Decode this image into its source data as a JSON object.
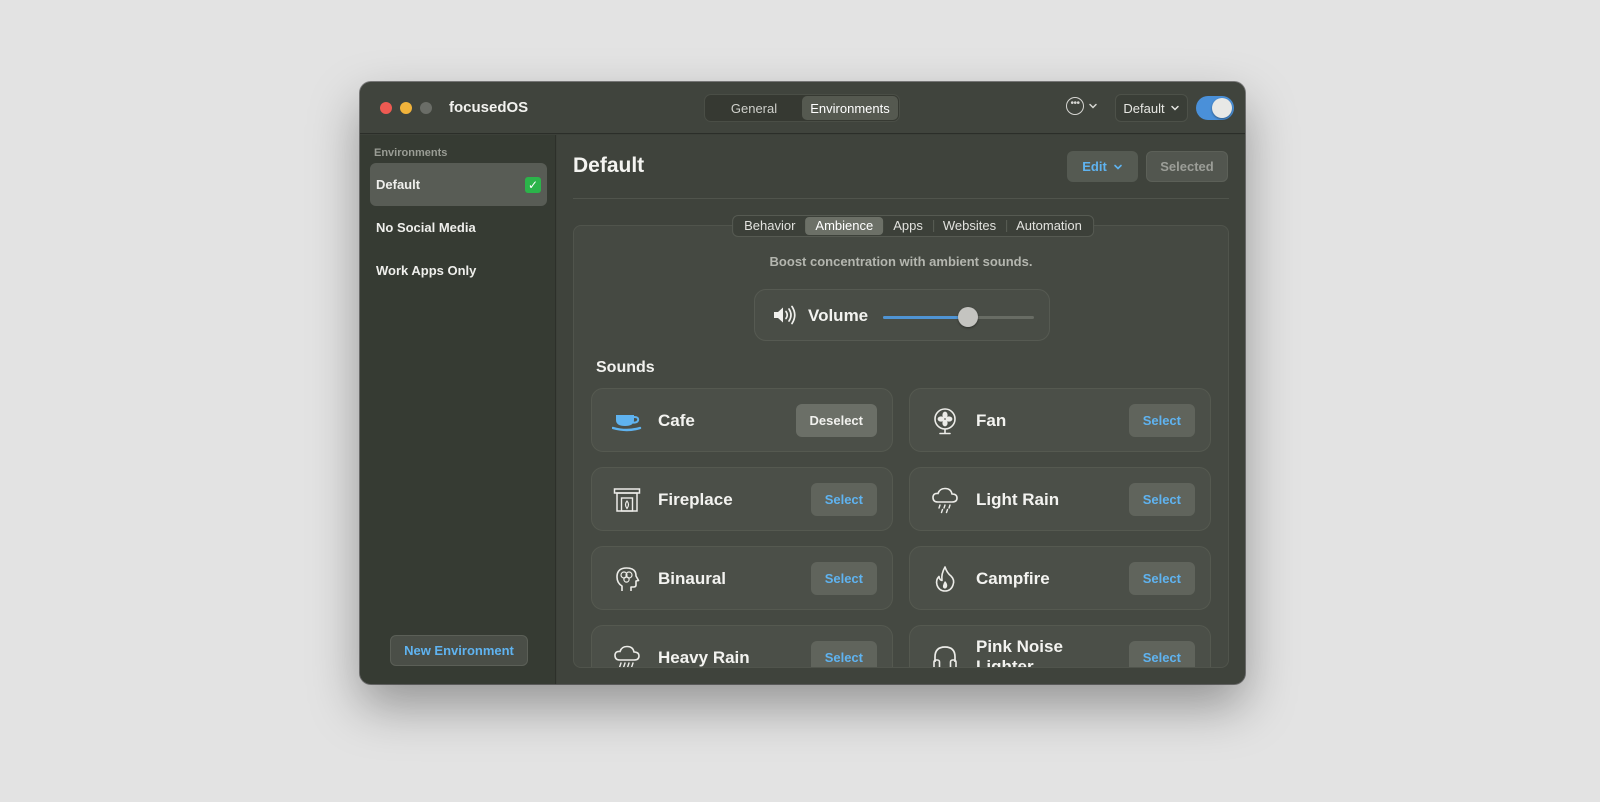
{
  "app": {
    "title": "focusedOS"
  },
  "titlebar": {
    "tabs": [
      {
        "label": "General",
        "active": false
      },
      {
        "label": "Environments",
        "active": true
      }
    ],
    "profile_dropdown": "Default",
    "toggle_on": true
  },
  "sidebar": {
    "heading": "Environments",
    "items": [
      {
        "label": "Default",
        "active": true,
        "badge": "✓"
      },
      {
        "label": "No Social Media",
        "active": false
      },
      {
        "label": "Work Apps Only",
        "active": false
      }
    ],
    "new_button": "New Environment"
  },
  "main": {
    "title": "Default",
    "edit_label": "Edit",
    "selected_label": "Selected",
    "tabs": [
      "Behavior",
      "Ambience",
      "Apps",
      "Websites",
      "Automation"
    ],
    "active_tab": "Ambience",
    "subtitle": "Boost concentration with ambient sounds.",
    "volume": {
      "label": "Volume",
      "level_percent": 56
    },
    "sounds_heading": "Sounds",
    "sounds": [
      {
        "name": "Cafe",
        "icon": "coffee-cup-icon",
        "button": "Deselect",
        "selected": true
      },
      {
        "name": "Fan",
        "icon": "fan-icon",
        "button": "Select",
        "selected": false
      },
      {
        "name": "Fireplace",
        "icon": "fireplace-icon",
        "button": "Select",
        "selected": false
      },
      {
        "name": "Light Rain",
        "icon": "cloud-drizzle-icon",
        "button": "Select",
        "selected": false
      },
      {
        "name": "Binaural",
        "icon": "brain-head-icon",
        "button": "Select",
        "selected": false
      },
      {
        "name": "Campfire",
        "icon": "flame-icon",
        "button": "Select",
        "selected": false
      },
      {
        "name": "Heavy Rain",
        "icon": "cloud-rain-icon",
        "button": "Select",
        "selected": false
      },
      {
        "name": "Pink Noise Lighter",
        "icon": "headphones-icon",
        "button": "Select",
        "selected": false
      }
    ]
  },
  "colors": {
    "accent": "#5fb3f0",
    "window_bg": "#3c4039",
    "sidebar_bg": "#363b33",
    "toggle": "#4a90d9",
    "check_green": "#2bb44a"
  }
}
